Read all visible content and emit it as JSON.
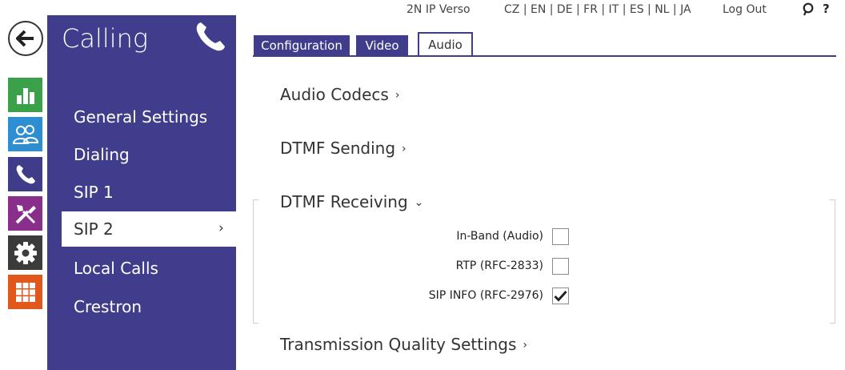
{
  "topbar": {
    "device": "2N IP Verso",
    "languages": "CZ | EN | DE | FR | IT | ES | NL | JA",
    "logout": "Log Out",
    "help": "?"
  },
  "rail": {
    "icons": [
      "back-arrow-icon",
      "bar-chart-icon",
      "users-icon",
      "phone-icon",
      "tools-icon",
      "gear-icon",
      "grid-icon"
    ]
  },
  "sidebar": {
    "title": "Calling",
    "items": [
      {
        "label": "General Settings"
      },
      {
        "label": "Dialing"
      },
      {
        "label": "SIP 1"
      },
      {
        "label": "SIP 2",
        "chevron": "›"
      },
      {
        "label": "Local Calls"
      },
      {
        "label": "Crestron"
      }
    ],
    "active_index": 3
  },
  "tabs": [
    {
      "label": "Configuration"
    },
    {
      "label": "Video"
    },
    {
      "label": "Audio"
    }
  ],
  "active_tab": "Audio",
  "sections": {
    "audio_codecs": {
      "title": "Audio Codecs",
      "chevron": "›"
    },
    "dtmf_sending": {
      "title": "DTMF Sending",
      "chevron": "›"
    },
    "dtmf_receiving": {
      "title": "DTMF Receiving",
      "chevron": "⌄",
      "options": [
        {
          "label": "In-Band (Audio)",
          "checked": false
        },
        {
          "label": "RTP (RFC-2833)",
          "checked": false
        },
        {
          "label": "SIP INFO (RFC-2976)",
          "checked": true
        }
      ]
    },
    "transmission_quality": {
      "title": "Transmission Quality Settings",
      "chevron": "›"
    }
  },
  "colors": {
    "sidebar": "#403e8c",
    "status": "#3aa04a",
    "directory": "#2d8fd1",
    "hardware": "#8a2e8c",
    "system": "#e2571c"
  }
}
